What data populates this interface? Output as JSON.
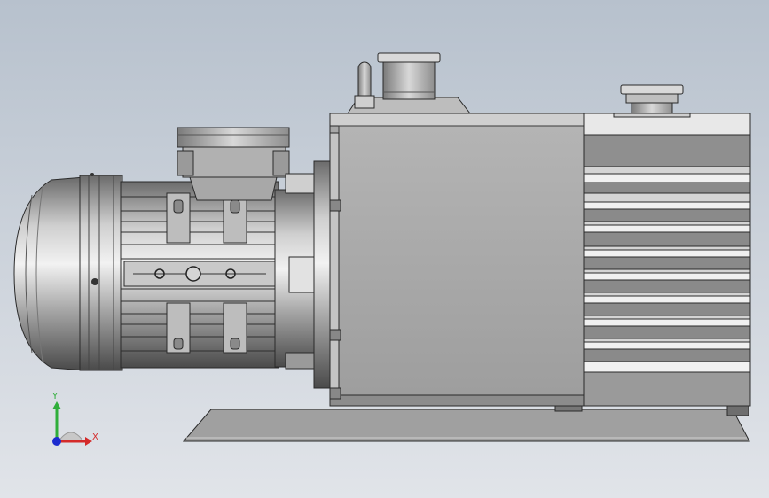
{
  "viewport": {
    "background_top": "#b9c3cf",
    "background_bottom": "#dfe3e8"
  },
  "model": {
    "description_icon": "vacuum-pump-model",
    "body_color": "#a9a9a9",
    "body_light": "#d6d6d6",
    "body_dark": "#5a5a5a",
    "edge_color": "#2a2a2a"
  },
  "triad": {
    "x_label": "X",
    "y_label": "Y",
    "x_color": "#d42a2a",
    "y_color": "#2fae3a",
    "z_color": "#1c2ccf"
  }
}
